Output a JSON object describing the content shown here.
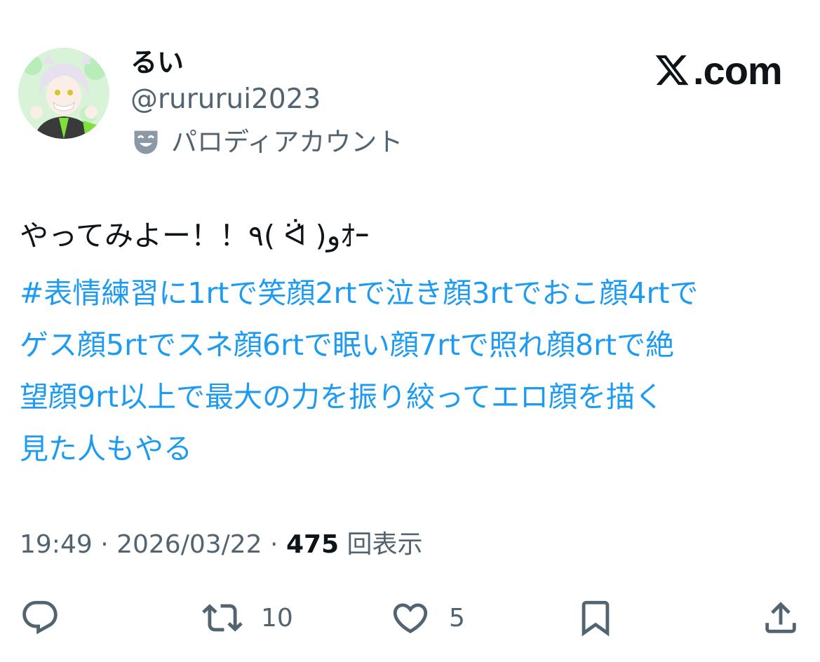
{
  "brand": {
    "label": ".com"
  },
  "author": {
    "name": "るい",
    "handle": "@rururui2023",
    "badge_label": "パロディアカウント"
  },
  "tweet": {
    "first_line": "やってみよー！！٩( ᐛ̇ )و‬ｵｰ",
    "hashtag_lines": [
      " #表情練習に1rtで笑顔2rtで泣き顔3rtでおこ顔4rtで",
      "ゲス顔5rtでスネ顔6rtで眠い顔7rtで照れ顔8rtで絶",
      "望顔9rt以上で最大の力を振り絞ってエロ顔を描く",
      "見た人もやる"
    ]
  },
  "meta": {
    "time": "19:49",
    "sep1": " · ",
    "date": "2026/03/22",
    "sep2": " · ",
    "views_count": "475",
    "views_label": " 回表示"
  },
  "actions": {
    "reply_count": "",
    "retweet_count": "10",
    "like_count": "5"
  },
  "colors": {
    "link": "#1d9bf0",
    "text": "#0f1419",
    "secondary": "#536471"
  }
}
